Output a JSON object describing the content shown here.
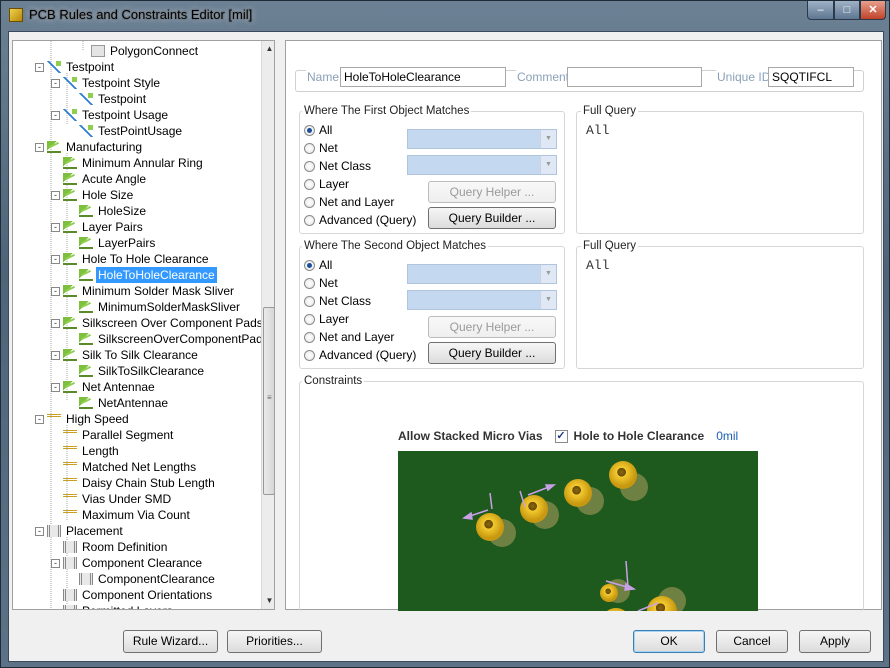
{
  "window": {
    "title": "PCB Rules and Constraints Editor [mil]"
  },
  "tree": {
    "items": [
      {
        "label": "PolygonConnect",
        "icon": "polygon-connect-icon"
      },
      {
        "label": "Testpoint",
        "icon": "testpoint-icon"
      },
      {
        "label": "Testpoint Style",
        "icon": "testpoint-icon"
      },
      {
        "label": "Testpoint",
        "icon": "testpoint-icon"
      },
      {
        "label": "Testpoint Usage",
        "icon": "testpoint-icon"
      },
      {
        "label": "TestPointUsage",
        "icon": "testpoint-icon"
      },
      {
        "label": "Manufacturing",
        "icon": "rule-icon"
      },
      {
        "label": "Minimum Annular Ring",
        "icon": "rule-icon"
      },
      {
        "label": "Acute Angle",
        "icon": "rule-icon"
      },
      {
        "label": "Hole Size",
        "icon": "rule-icon"
      },
      {
        "label": "HoleSize",
        "icon": "rule-icon"
      },
      {
        "label": "Layer Pairs",
        "icon": "rule-icon"
      },
      {
        "label": "LayerPairs",
        "icon": "rule-icon"
      },
      {
        "label": "Hole To Hole Clearance",
        "icon": "rule-icon"
      },
      {
        "label": "HoleToHoleClearance",
        "icon": "rule-icon"
      },
      {
        "label": "Minimum Solder Mask Sliver",
        "icon": "rule-icon"
      },
      {
        "label": "MinimumSolderMaskSliver",
        "icon": "rule-icon"
      },
      {
        "label": "Silkscreen Over Component Pads",
        "icon": "rule-icon"
      },
      {
        "label": "SilkscreenOverComponentPads",
        "icon": "rule-icon"
      },
      {
        "label": "Silk To Silk Clearance",
        "icon": "rule-icon"
      },
      {
        "label": "SilkToSilkClearance",
        "icon": "rule-icon"
      },
      {
        "label": "Net Antennae",
        "icon": "rule-icon"
      },
      {
        "label": "NetAntennae",
        "icon": "rule-icon"
      },
      {
        "label": "High Speed",
        "icon": "high-speed-icon"
      },
      {
        "label": "Parallel Segment",
        "icon": "high-speed-icon"
      },
      {
        "label": "Length",
        "icon": "high-speed-icon"
      },
      {
        "label": "Matched Net Lengths",
        "icon": "high-speed-icon"
      },
      {
        "label": "Daisy Chain Stub Length",
        "icon": "high-speed-icon"
      },
      {
        "label": "Vias Under SMD",
        "icon": "high-speed-icon"
      },
      {
        "label": "Maximum Via Count",
        "icon": "high-speed-icon"
      },
      {
        "label": "Placement",
        "icon": "placement-icon"
      },
      {
        "label": "Room Definition",
        "icon": "placement-icon"
      },
      {
        "label": "Component Clearance",
        "icon": "placement-icon"
      },
      {
        "label": "ComponentClearance",
        "icon": "placement-icon"
      },
      {
        "label": "Component Orientations",
        "icon": "placement-icon"
      },
      {
        "label": "Permitted Layers",
        "icon": "placement-icon"
      }
    ],
    "selected_index": 14
  },
  "header": {
    "name_label": "Name",
    "name_value": "HoleToHoleClearance",
    "comment_label": "Comment",
    "comment_value": "",
    "uid_label": "Unique ID",
    "uid_value": "SQQTIFCL"
  },
  "first_match": {
    "title": "Where The First Object Matches",
    "options": [
      "All",
      "Net",
      "Net Class",
      "Layer",
      "Net and Layer",
      "Advanced (Query)"
    ],
    "selected": "All",
    "query_helper": "Query Helper ...",
    "query_builder": "Query Builder ...",
    "full_query_title": "Full Query",
    "full_query": "All"
  },
  "second_match": {
    "title": "Where The Second Object Matches",
    "options": [
      "All",
      "Net",
      "Net Class",
      "Layer",
      "Net and Layer",
      "Advanced (Query)"
    ],
    "selected": "All",
    "query_helper": "Query Helper ...",
    "query_builder": "Query Builder ...",
    "full_query_title": "Full Query",
    "full_query": "All"
  },
  "constraints": {
    "title": "Constraints",
    "stacked_label": "Allow Stacked Micro Vias",
    "stacked_checked": true,
    "clearance_label": "Hole to Hole Clearance",
    "clearance_value": "0mil"
  },
  "colors": {
    "pcb_bg": "#1e5a1e",
    "pad": "#e8b818",
    "selection": "#3399ff",
    "dimension": "#c8a0e8"
  },
  "buttons": {
    "rule_wizard": "Rule Wizard...",
    "priorities": "Priorities...",
    "ok": "OK",
    "cancel": "Cancel",
    "apply": "Apply"
  }
}
